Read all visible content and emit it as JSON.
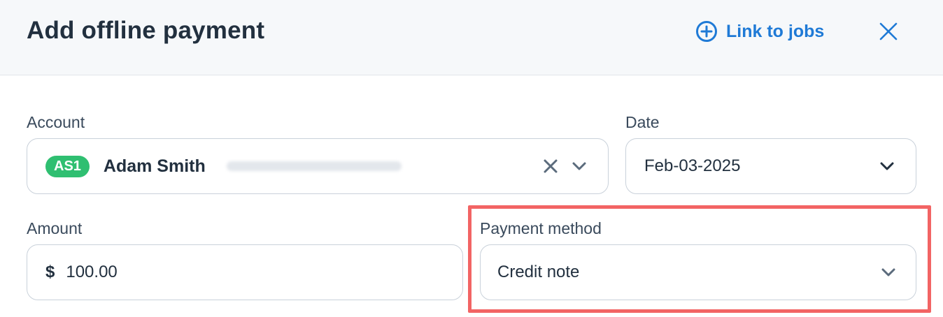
{
  "header": {
    "title": "Add offline payment",
    "link_label": "Link to jobs"
  },
  "account": {
    "label": "Account",
    "badge": "AS1",
    "name": "Adam Smith",
    "badge_color": "#2fbf71"
  },
  "date": {
    "label": "Date",
    "value": "Feb-03-2025"
  },
  "amount": {
    "label": "Amount",
    "currency": "$",
    "value": "100.00"
  },
  "payment_method": {
    "label": "Payment method",
    "value": "Credit note"
  },
  "colors": {
    "accent": "#1f7ad6",
    "highlight": "#f26464"
  }
}
